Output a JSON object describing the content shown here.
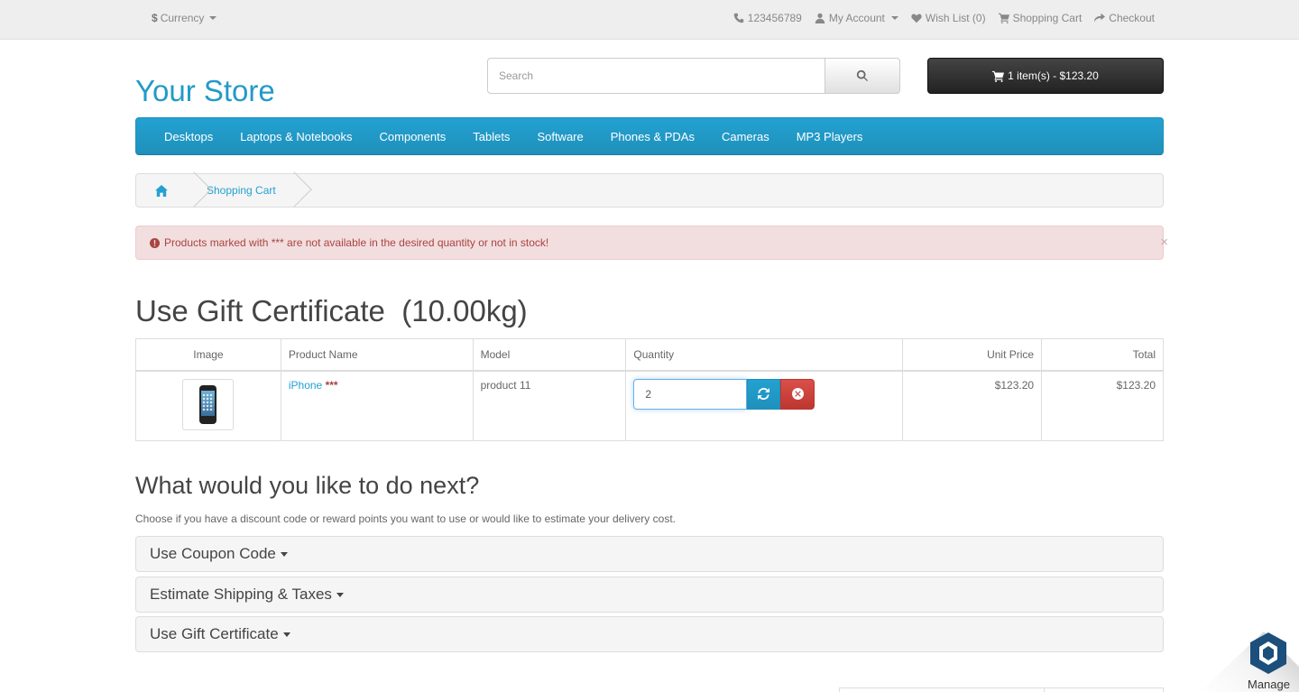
{
  "topbar": {
    "currency_symbol": "$",
    "currency_label": "Currency",
    "phone": "123456789",
    "my_account": "My Account",
    "wish_list": "Wish List (0)",
    "shopping_cart": "Shopping Cart",
    "checkout": "Checkout"
  },
  "header": {
    "logo": "Your Store",
    "search_placeholder": "Search",
    "cart_summary": "1 item(s) - $123.20"
  },
  "menu": {
    "items": [
      "Desktops",
      "Laptops & Notebooks",
      "Components",
      "Tablets",
      "Software",
      "Phones & PDAs",
      "Cameras",
      "MP3 Players"
    ]
  },
  "breadcrumb": {
    "home_icon": "home-icon",
    "current": "Shopping Cart"
  },
  "alert": {
    "message": "Products marked with *** are not available in the desired quantity or not in stock!",
    "close": "×",
    "color": "#a94442"
  },
  "page": {
    "title": "Use Gift Certificate  (10.00kg)"
  },
  "cart_table": {
    "headers": {
      "image": "Image",
      "name": "Product Name",
      "model": "Model",
      "quantity": "Quantity",
      "unit_price": "Unit Price",
      "total": "Total"
    },
    "rows": [
      {
        "name": "iPhone",
        "stock_flag": "***",
        "model": "product 11",
        "quantity": "2",
        "unit_price": "$123.20",
        "total": "$123.20"
      }
    ]
  },
  "next": {
    "heading": "What would you like to do next?",
    "description": "Choose if you have a discount code or reward points you want to use or would like to estimate your delivery cost.",
    "panels": [
      "Use Coupon Code",
      "Estimate Shipping & Taxes",
      "Use Gift Certificate"
    ]
  },
  "widget": {
    "label": "Manage"
  },
  "colors": {
    "accent": "#229ac8",
    "menu": "#23a1d1",
    "danger": "#da4f49",
    "cart_button": "#333333"
  }
}
